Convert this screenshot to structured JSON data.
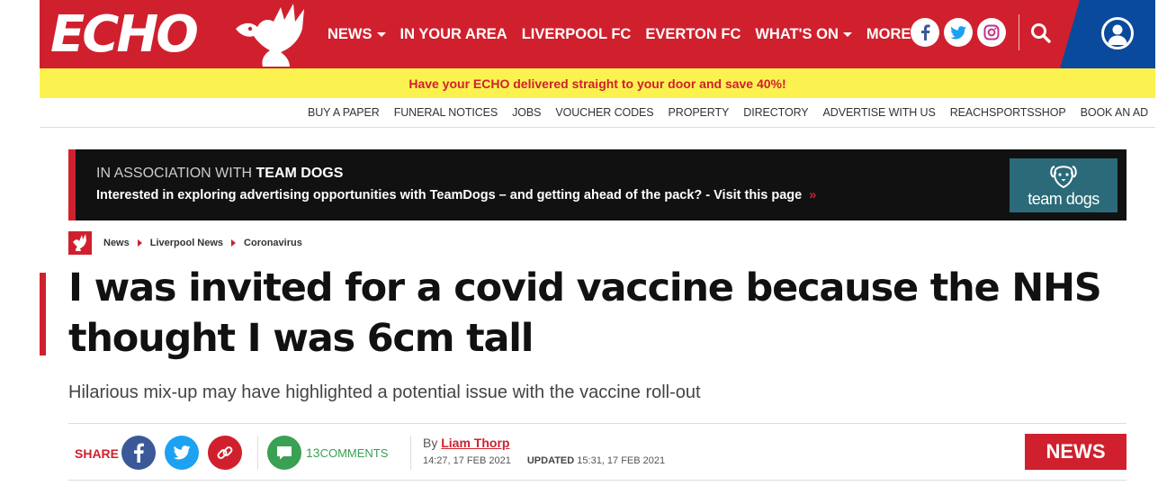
{
  "header": {
    "logo_text": "ECHO",
    "nav": [
      {
        "label": "NEWS",
        "dropdown": true
      },
      {
        "label": "IN YOUR AREA",
        "dropdown": false
      },
      {
        "label": "LIVERPOOL FC",
        "dropdown": false
      },
      {
        "label": "EVERTON FC",
        "dropdown": false
      },
      {
        "label": "WHAT'S ON",
        "dropdown": true
      },
      {
        "label": "MORE",
        "dropdown": true
      }
    ],
    "social_icons": [
      "facebook-icon",
      "twitter-icon",
      "instagram-icon"
    ],
    "brand_red": "#d0202d",
    "account_blue": "#0a4a9c"
  },
  "promo": {
    "text": "Have your ECHO delivered straight to your door and save 40%!"
  },
  "utility_nav": [
    "BUY A PAPER",
    "FUNERAL NOTICES",
    "JOBS",
    "VOUCHER CODES",
    "PROPERTY",
    "DIRECTORY",
    "ADVERTISE WITH US",
    "REACHSPORTSSHOP",
    "BOOK AN AD"
  ],
  "sponsor": {
    "prefix": "IN ASSOCIATION WITH",
    "partner": "TEAM DOGS",
    "message": "Interested in exploring advertising opportunities with TeamDogs – and getting ahead of the pack? - Visit this page",
    "arrows": "»",
    "logo_label": "team dogs"
  },
  "breadcrumb": [
    "News",
    "Liverpool News",
    "Coronavirus"
  ],
  "article": {
    "headline": "I was invited for a covid vaccine because the NHS thought I was 6cm tall",
    "standfirst": "Hilarious mix-up may have highlighted a potential issue with the vaccine roll-out"
  },
  "share": {
    "label": "SHARE",
    "comments_count": "13",
    "comments_label": "COMMENTS"
  },
  "byline": {
    "by": "By",
    "author": "Liam Thorp",
    "published": "14:27, 17 FEB 2021",
    "updated_label": "UPDATED",
    "updated": "15:31, 17 FEB 2021"
  },
  "section": {
    "label": "NEWS"
  }
}
